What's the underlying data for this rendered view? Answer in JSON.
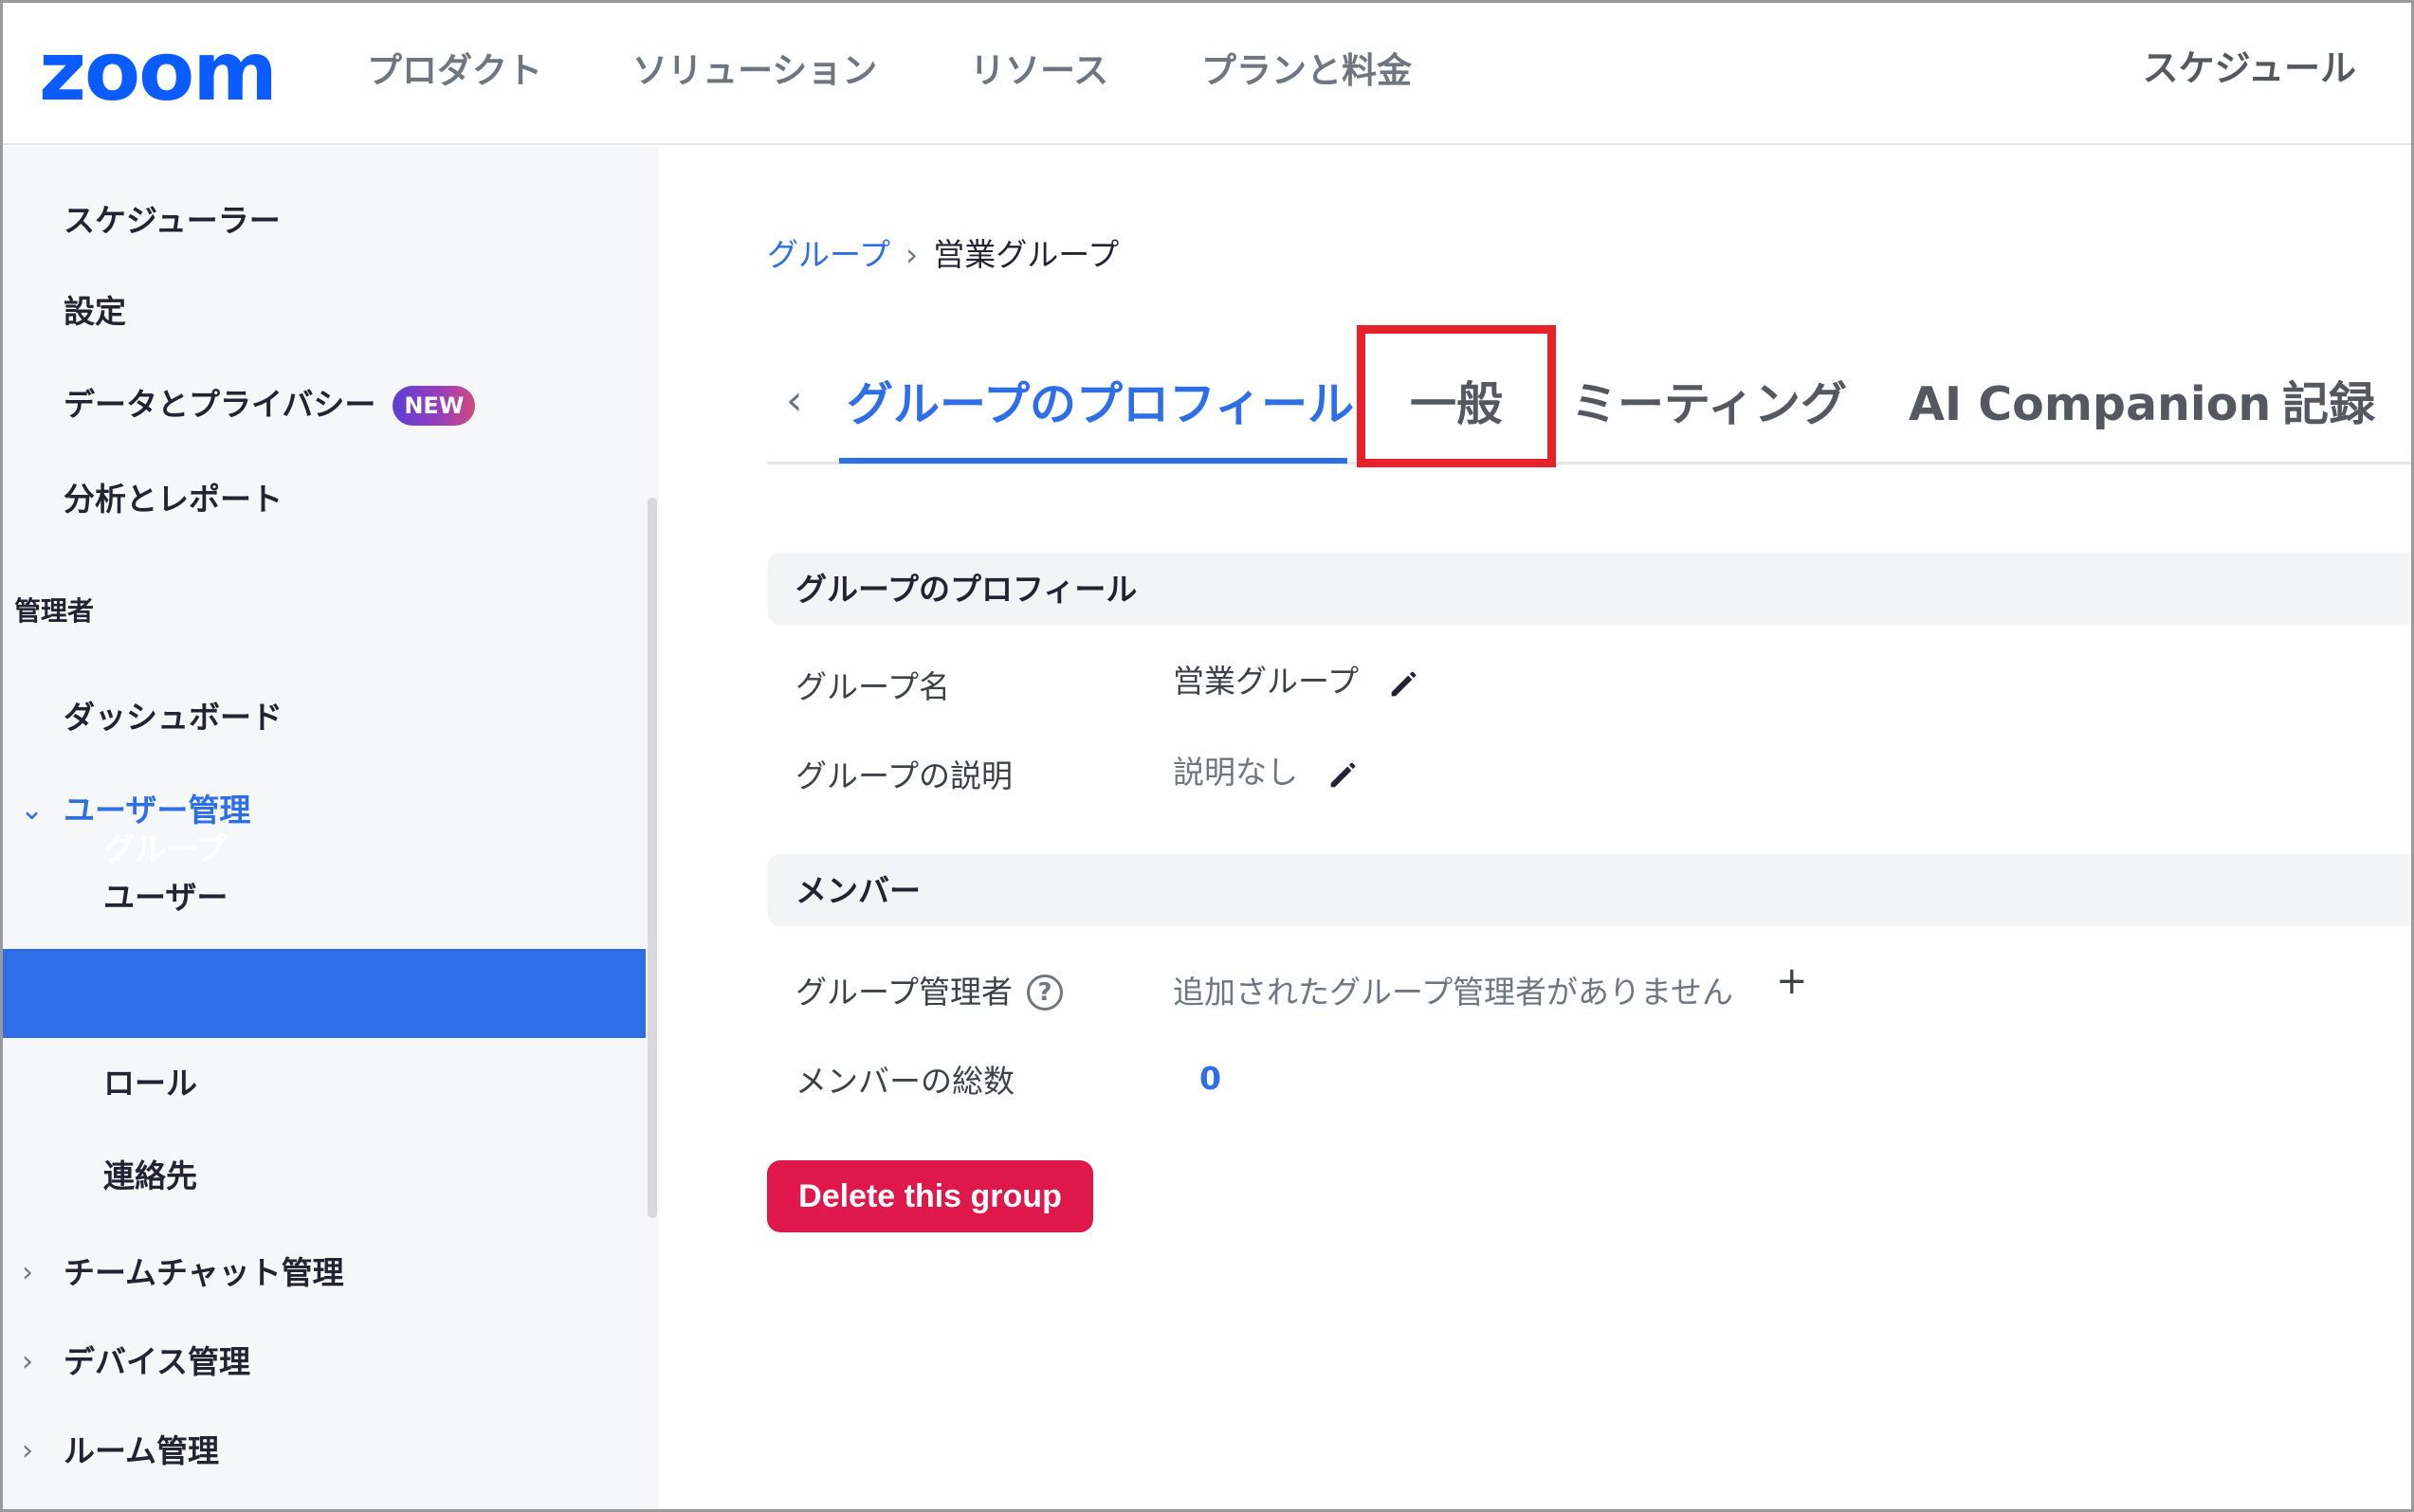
{
  "app": {
    "logo": "zoom",
    "nav": [
      "プロダクト",
      "ソリューション",
      "リソース",
      "プランと料金"
    ],
    "nav_right": "スケジュール"
  },
  "sidebar": {
    "items_top": [
      "スケジューラー",
      "設定",
      "データとプライバシー",
      "分析とレポート"
    ],
    "new_badge": "NEW",
    "section_admin": "管理者",
    "dashboard": "ダッシュボード",
    "user_mgmt": "ユーザー管理",
    "user_mgmt_children": [
      "ユーザー",
      "グループ",
      "ロール",
      "連絡先"
    ],
    "active_item": "グループ",
    "collapsed_groups": [
      "チームチャット管理",
      "デバイス管理",
      "ルーム管理"
    ]
  },
  "breadcrumb": {
    "parent": "グループ",
    "separator": "›",
    "current": "営業グループ"
  },
  "tabs": {
    "back": "‹",
    "items": [
      "グループのプロフィール",
      "一般",
      "ミーティング",
      "AI Companion",
      "記録"
    ],
    "active": "グループのプロフィール",
    "highlighted": "一般"
  },
  "profile_section": {
    "title": "グループのプロフィール",
    "name_label": "グループ名",
    "name_value": "営業グループ",
    "desc_label": "グループの説明",
    "desc_value": "説明なし"
  },
  "members_section": {
    "title": "メンバー",
    "admin_label": "グループ管理者",
    "admin_help": "?",
    "admin_value": "追加されたグループ管理者がありません",
    "add_icon": "+",
    "total_label": "メンバーの総数",
    "total_value": "0"
  },
  "actions": {
    "delete_label": "Delete this group"
  },
  "colors": {
    "brand": "#0b5cff",
    "accent": "#2e6fe8",
    "danger": "#e0174a",
    "highlight": "#e8202a"
  }
}
